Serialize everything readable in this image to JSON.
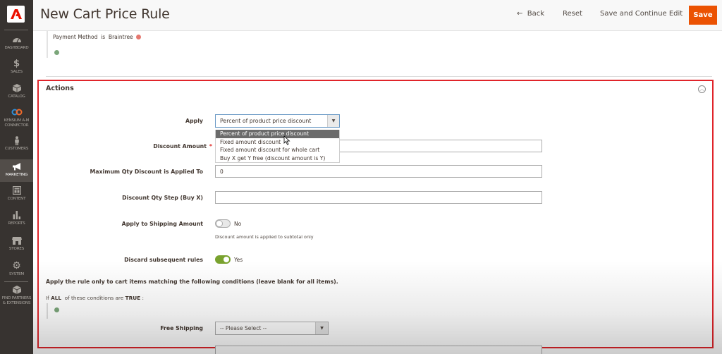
{
  "sidebar": {
    "logo": "adobe-logo",
    "items": [
      {
        "label": "DASHBOARD",
        "icon": "speedometer-icon"
      },
      {
        "label": "SALES",
        "icon": "dollar-icon"
      },
      {
        "label": "CATALOG",
        "icon": "box-icon"
      },
      {
        "label": "KENSIUM A-M CONNECTOR",
        "label_line1": "KENSIUM A-M",
        "label_line2": "CONNECTOR",
        "icon": "connector-icon"
      },
      {
        "label": "CUSTOMERS",
        "icon": "person-icon"
      },
      {
        "label": "MARKETING",
        "icon": "megaphone-icon",
        "active": true
      },
      {
        "label": "CONTENT",
        "icon": "layout-icon"
      },
      {
        "label": "REPORTS",
        "icon": "bar-chart-icon"
      },
      {
        "label": "STORES",
        "icon": "storefront-icon"
      },
      {
        "label": "SYSTEM",
        "icon": "gear-icon"
      },
      {
        "label": "FIND PARTNERS & EXTENSIONS",
        "label_line1": "FIND PARTNERS",
        "label_line2": "& EXTENSIONS",
        "icon": "cube-icon"
      }
    ]
  },
  "header": {
    "title": "New Cart Price Rule",
    "back_label": "Back",
    "reset_label": "Reset",
    "save_continue_label": "Save and Continue Edit",
    "save_label": "Save",
    "accent_color": "#eb5202"
  },
  "conditions_top": {
    "attribute": "Payment Method",
    "operator": "is",
    "value": "Braintree"
  },
  "actions": {
    "title": "Actions",
    "apply": {
      "label": "Apply",
      "value": "Percent of product price discount",
      "options": [
        "Percent of product price discount",
        "Fixed amount discount",
        "Fixed amount discount for whole cart",
        "Buy X get Y free (discount amount is Y)"
      ],
      "highlighted_option": "Percent of product price discount"
    },
    "discount_amount": {
      "label": "Discount Amount",
      "required_mark": "*",
      "value": ""
    },
    "max_qty": {
      "label": "Maximum Qty Discount is Applied To",
      "value": "0"
    },
    "qty_step": {
      "label": "Discount Qty Step (Buy X)",
      "value": ""
    },
    "apply_shipping": {
      "label": "Apply to Shipping Amount",
      "state": "No",
      "enabled": false,
      "note": "Discount amount is applied to subtotal only"
    },
    "discard_rules": {
      "label": "Discard subsequent rules",
      "state": "Yes",
      "enabled": true
    },
    "conditions_text": "Apply the rule only to cart items matching the following conditions (leave blank for all items).",
    "if_prefix": "If",
    "if_all": "ALL",
    "if_middle": "of these conditions are",
    "if_true": "TRUE",
    "if_suffix": ":",
    "free_shipping": {
      "label": "Free Shipping",
      "value": "-- Please Select --"
    }
  }
}
